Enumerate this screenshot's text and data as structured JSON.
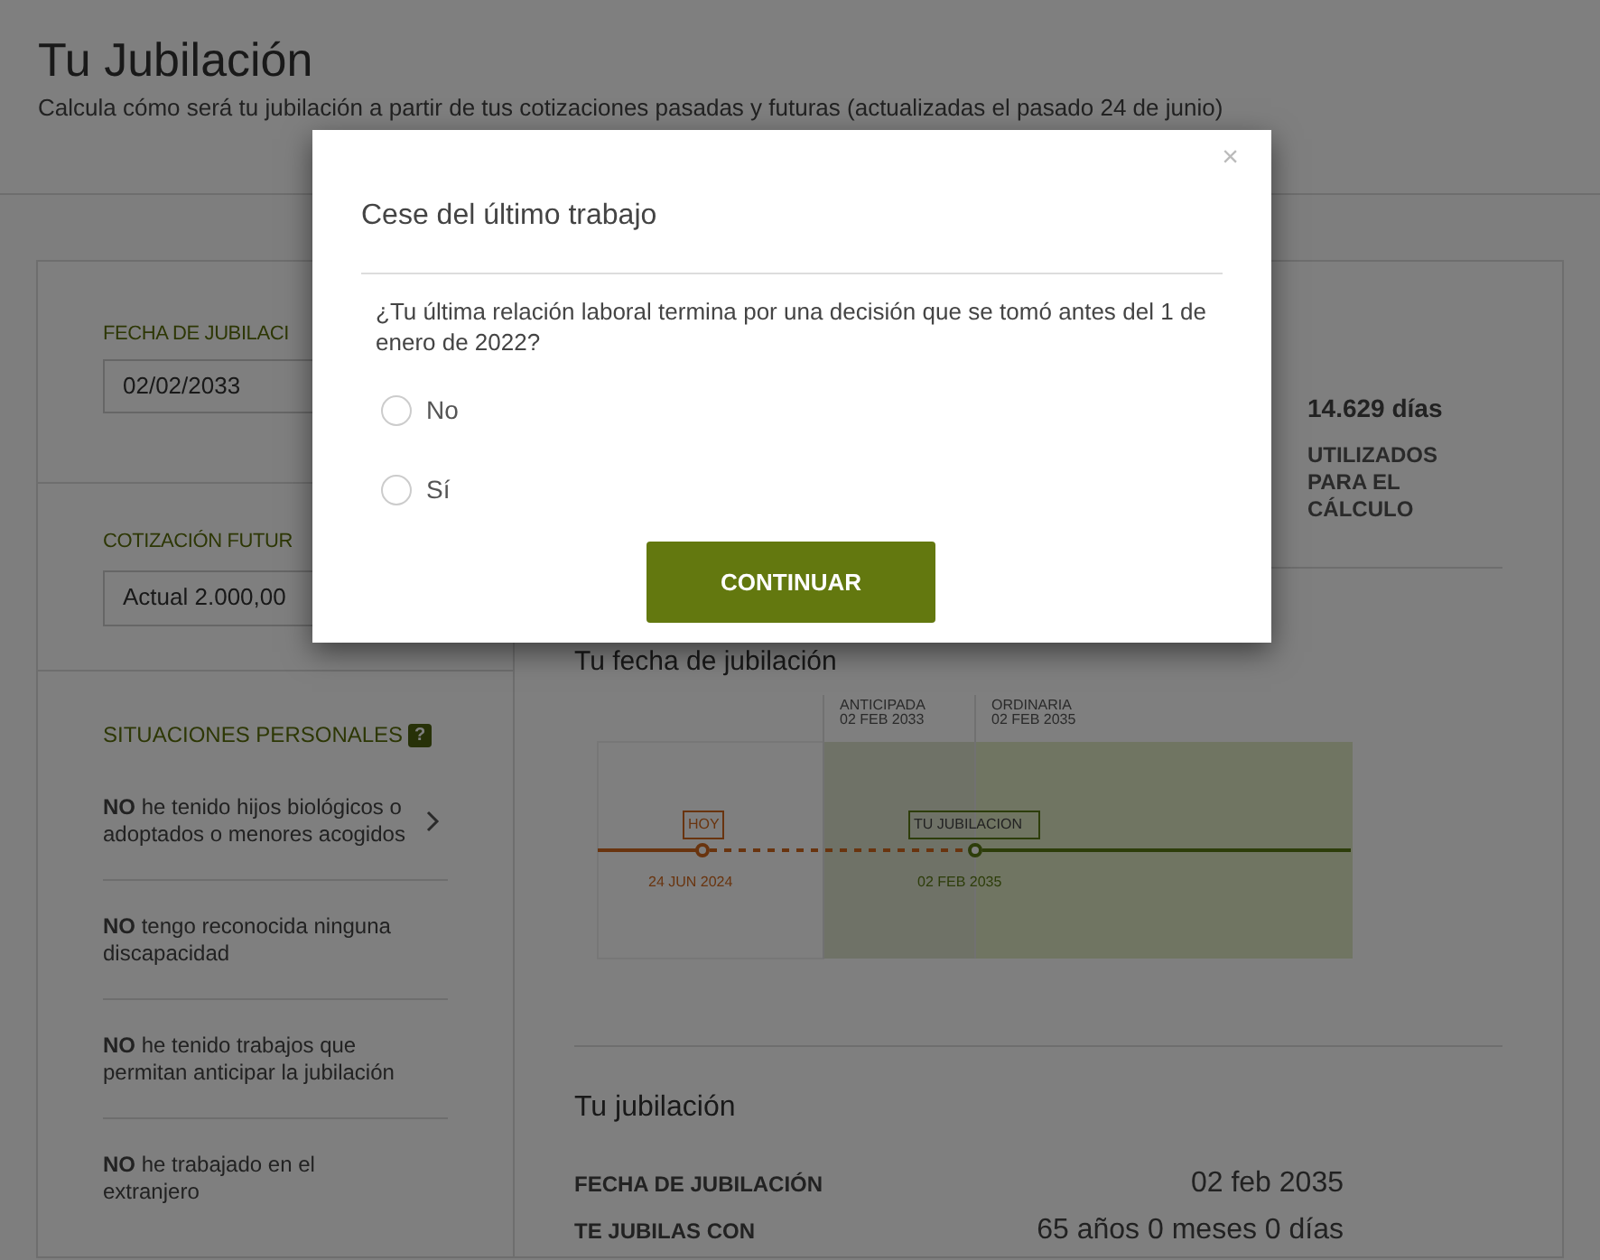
{
  "page": {
    "title": "Tu Jubilación",
    "subtitle": "Calcula cómo será tu jubilación a partir de tus cotizaciones pasadas y futuras (actualizadas el pasado 24 de junio)"
  },
  "left_panel": {
    "retirement_date": {
      "label": "FECHA DE JUBILACI",
      "value": "02/02/2033"
    },
    "future_contribution": {
      "label": "COTIZACIÓN FUTUR",
      "value": "Actual 2.000,00"
    },
    "personal_situations": {
      "title": "SITUACIONES PERSONALES",
      "help": "?",
      "items": [
        {
          "text": "**NO** he tenido hijos biológicos o adoptados o menores acogidos",
          "arrow": true
        },
        {
          "text": "**NO** tengo reconocida ninguna discapacidad",
          "arrow": false
        },
        {
          "text": "**NO** he tenido trabajos que permitan anticipar la jubilación",
          "arrow": false
        },
        {
          "text": "**NO** he trabajado en el extranjero",
          "arrow": false
        }
      ]
    }
  },
  "summary": {
    "days": "14.629 días",
    "caption": "UTILIZADOS PARA EL CÁLCULO"
  },
  "timeline": {
    "title": "Tu fecha de jubilación",
    "early": {
      "label": "ANTICIPADA",
      "date": "02 FEB 2033"
    },
    "ordinary": {
      "label": "ORDINARIA",
      "date": "02 FEB 2035"
    },
    "today": {
      "label": "HOY",
      "date": "24 JUN 2024"
    },
    "retirement": {
      "label": "TU JUBILACION",
      "date": "02 FEB 2035"
    }
  },
  "result": {
    "title": "Tu jubilación",
    "rows": [
      {
        "label": "FECHA DE JUBILACIÓN",
        "value": "02 feb 2035"
      },
      {
        "label": "TE JUBILAS CON",
        "value": "65 años 0 meses 0 días"
      }
    ]
  },
  "modal": {
    "title": "Cese del último trabajo",
    "close": "×",
    "question": "¿Tu última relación laboral termina por una decisión que se tomó antes del 1 de enero de 2022?",
    "options": [
      {
        "label": "No",
        "selected": false
      },
      {
        "label": "Sí",
        "selected": false
      }
    ],
    "button": "CONTINUAR"
  }
}
